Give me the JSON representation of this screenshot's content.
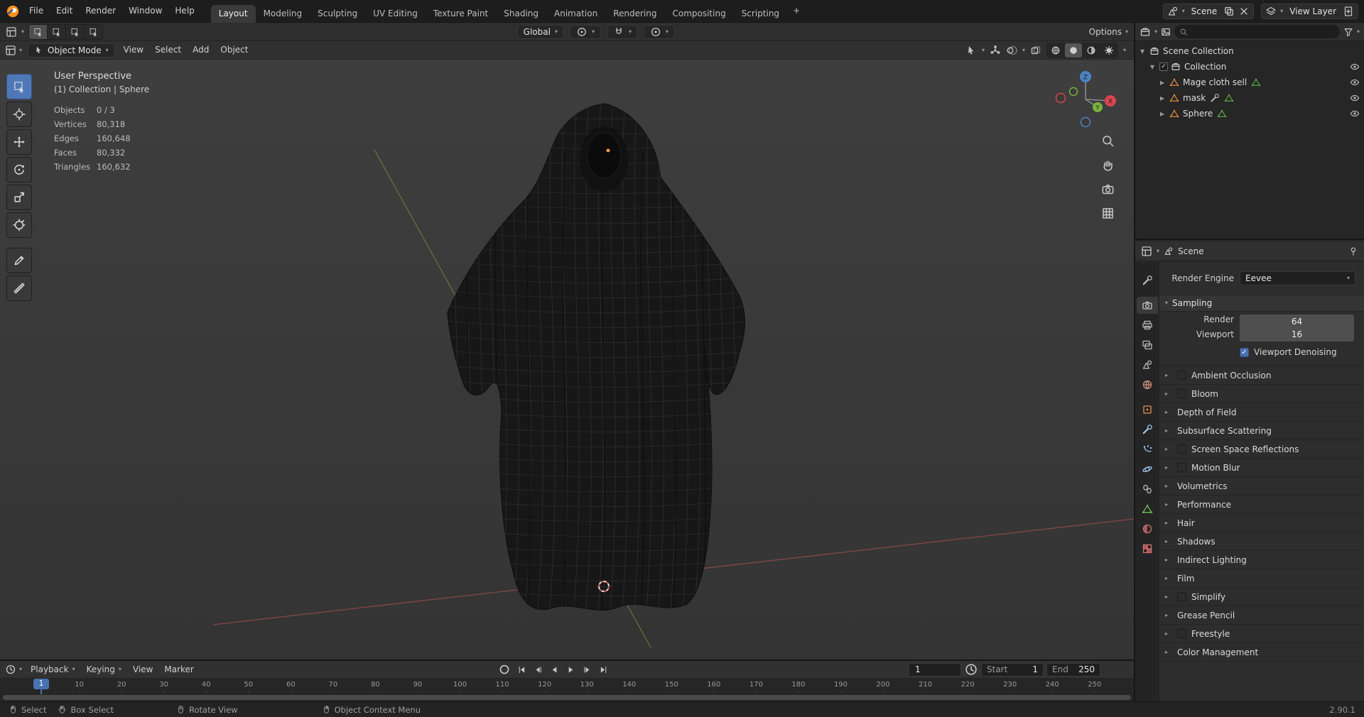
{
  "colors": {
    "accent": "#4772b3",
    "object_orange": "#e8913d",
    "badge_green": "#5fae46",
    "axis_x": "#d8454f",
    "axis_y": "#78b33e",
    "axis_z": "#4a84c7"
  },
  "topbar": {
    "menus": [
      "File",
      "Edit",
      "Render",
      "Window",
      "Help"
    ],
    "workspaces": [
      "Layout",
      "Modeling",
      "Sculpting",
      "UV Editing",
      "Texture Paint",
      "Shading",
      "Animation",
      "Rendering",
      "Compositing",
      "Scripting"
    ],
    "active_workspace": "Layout",
    "add_workspace_label": "+",
    "scene": {
      "label": "Scene"
    },
    "view_layer": {
      "label": "View Layer"
    }
  },
  "tool_settings": {
    "orientation": "Global",
    "options_label": "Options"
  },
  "viewport_header": {
    "mode": "Object Mode",
    "menus": [
      "View",
      "Select",
      "Add",
      "Object"
    ]
  },
  "viewport": {
    "overlay": {
      "view_label": "User Perspective",
      "context_label": "(1) Collection | Sphere",
      "stats": [
        {
          "label": "Objects",
          "value": "0 / 3"
        },
        {
          "label": "Vertices",
          "value": "80,318"
        },
        {
          "label": "Edges",
          "value": "160,648"
        },
        {
          "label": "Faces",
          "value": "80,332"
        },
        {
          "label": "Triangles",
          "value": "160,632"
        }
      ]
    },
    "tools": [
      "select-box",
      "cursor",
      "move",
      "rotate",
      "scale",
      "transform",
      "annotate",
      "measure"
    ],
    "nav_buttons": [
      "zoom",
      "pan",
      "camera",
      "ortho"
    ]
  },
  "outliner": {
    "search_placeholder": "",
    "rows": [
      {
        "indent": 0,
        "expander": "▾",
        "icon": "collection",
        "label": "Scene Collection",
        "checkbox": false,
        "badges": [],
        "eye": false
      },
      {
        "indent": 1,
        "expander": "▾",
        "icon": "collection",
        "label": "Collection",
        "checkbox": true,
        "badges": [],
        "eye": true
      },
      {
        "indent": 2,
        "expander": "▸",
        "icon": "mesh",
        "label": "Mage cloth sell",
        "checkbox": false,
        "badges": [
          "data"
        ],
        "eye": true
      },
      {
        "indent": 2,
        "expander": "▸",
        "icon": "mesh",
        "label": "mask",
        "checkbox": false,
        "badges": [
          "modifier",
          "data"
        ],
        "eye": true
      },
      {
        "indent": 2,
        "expander": "▸",
        "icon": "mesh",
        "label": "Sphere",
        "checkbox": false,
        "badges": [
          "data"
        ],
        "eye": true
      }
    ]
  },
  "properties": {
    "breadcrumb": "Scene",
    "render_engine_label": "Render Engine",
    "render_engine_value": "Eevee",
    "sampling_title": "Sampling",
    "sampling_rows": [
      {
        "label": "Render",
        "value": "64"
      },
      {
        "label": "Viewport",
        "value": "16"
      }
    ],
    "denoising_label": "Viewport Denoising",
    "denoising_checked": true,
    "tabs": [
      {
        "icon": "wrench",
        "name": "tool",
        "color": "#bdbdbd",
        "active": false
      },
      {
        "icon": "camera",
        "name": "render",
        "color": "#c8c8c8",
        "active": true
      },
      {
        "icon": "output",
        "name": "output",
        "color": "#bdbdbd",
        "active": false
      },
      {
        "icon": "view-layer",
        "name": "view-layer",
        "color": "#bdbdbd",
        "active": false
      },
      {
        "icon": "scene",
        "name": "scene",
        "color": "#bdbdbd",
        "active": false
      },
      {
        "icon": "world",
        "name": "world",
        "color": "#c98f7a",
        "active": false
      },
      {
        "icon": "object",
        "name": "object",
        "color": "#e8934a",
        "active": false
      },
      {
        "icon": "wrench",
        "name": "modifiers",
        "color": "#9fc3e8",
        "active": false
      },
      {
        "icon": "particles",
        "name": "particles",
        "color": "#9fc3e8",
        "active": false
      },
      {
        "icon": "physics",
        "name": "physics",
        "color": "#9fc3e8",
        "active": false
      },
      {
        "icon": "constraints",
        "name": "constraints",
        "color": "#bdbdbd",
        "active": false
      },
      {
        "icon": "mesh",
        "name": "object-data",
        "color": "#6fbf5a",
        "active": false
      },
      {
        "icon": "material",
        "name": "material",
        "color": "#d97070",
        "active": false
      },
      {
        "icon": "texture",
        "name": "texture",
        "color": "#d97070",
        "active": false
      }
    ],
    "sections": [
      {
        "label": "Ambient Occlusion",
        "checkbox": true
      },
      {
        "label": "Bloom",
        "checkbox": true
      },
      {
        "label": "Depth of Field",
        "checkbox": false
      },
      {
        "label": "Subsurface Scattering",
        "checkbox": false
      },
      {
        "label": "Screen Space Reflections",
        "checkbox": true
      },
      {
        "label": "Motion Blur",
        "checkbox": true
      },
      {
        "label": "Volumetrics",
        "checkbox": false
      },
      {
        "label": "Performance",
        "checkbox": false
      },
      {
        "label": "Hair",
        "checkbox": false
      },
      {
        "label": "Shadows",
        "checkbox": false
      },
      {
        "label": "Indirect Lighting",
        "checkbox": false
      },
      {
        "label": "Film",
        "checkbox": false
      },
      {
        "label": "Simplify",
        "checkbox": true
      },
      {
        "label": "Grease Pencil",
        "checkbox": false
      },
      {
        "label": "Freestyle",
        "checkbox": true
      },
      {
        "label": "Color Management",
        "checkbox": false
      }
    ]
  },
  "timeline": {
    "menus": [
      {
        "label": "Playback",
        "arrow": true
      },
      {
        "label": "Keying",
        "arrow": true
      },
      {
        "label": "View",
        "arrow": false
      },
      {
        "label": "Marker",
        "arrow": false
      }
    ],
    "current_frame": "1",
    "start_label": "Start",
    "start_value": "1",
    "end_label": "End",
    "end_value": "250",
    "ticks": [
      10,
      20,
      30,
      40,
      50,
      60,
      70,
      80,
      90,
      100,
      110,
      120,
      130,
      140,
      150,
      160,
      170,
      180,
      190,
      200,
      210,
      220,
      230,
      240,
      250
    ]
  },
  "statusbar": {
    "hints": [
      {
        "icon": "mouse-lmb",
        "label": "Select"
      },
      {
        "icon": "mouse-drag",
        "label": "Box Select"
      },
      {
        "icon": "mouse-mmb",
        "label": "Rotate View"
      },
      {
        "icon": "mouse-rmb",
        "label": "Object Context Menu"
      }
    ],
    "version": "2.90.1"
  }
}
